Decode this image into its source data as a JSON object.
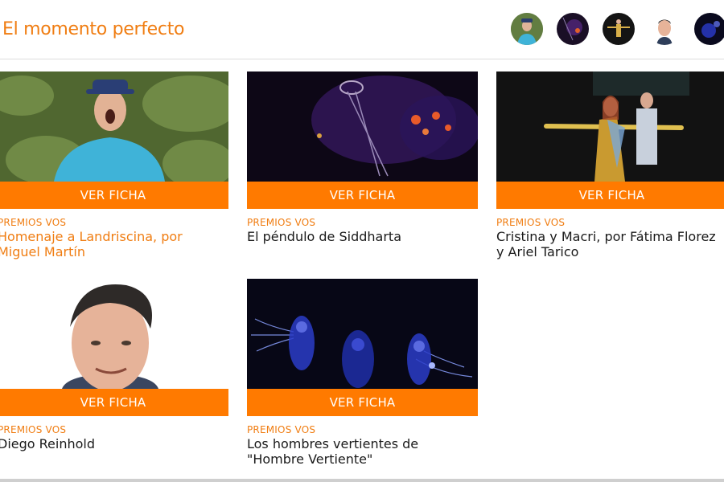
{
  "section": {
    "title": "El momento perfecto"
  },
  "colors": {
    "accent": "#ff7a00",
    "accent_text": "#f07d12"
  },
  "avatars": [
    {
      "name": "avatar-miguel-martin"
    },
    {
      "name": "avatar-siddharta"
    },
    {
      "name": "avatar-cristina-macri"
    },
    {
      "name": "avatar-diego-reinhold"
    },
    {
      "name": "avatar-hombre-vertiente"
    }
  ],
  "cards": [
    {
      "button": "VER FICHA",
      "category": "PREMIOS VOS",
      "title": "Homenaje a Landriscina, por Miguel Martín"
    },
    {
      "button": "VER FICHA",
      "category": "PREMIOS VOS",
      "title": "El péndulo de Siddharta"
    },
    {
      "button": "VER FICHA",
      "category": "PREMIOS VOS",
      "title": "Cristina y Macri, por Fátima Florez y Ariel Tarico"
    },
    {
      "button": "VER FICHA",
      "category": "PREMIOS VOS",
      "title": "Diego Reinhold"
    },
    {
      "button": "VER FICHA",
      "category": "PREMIOS VOS",
      "title": "Los hombres vertientes de \"Hombre Vertiente\""
    }
  ]
}
